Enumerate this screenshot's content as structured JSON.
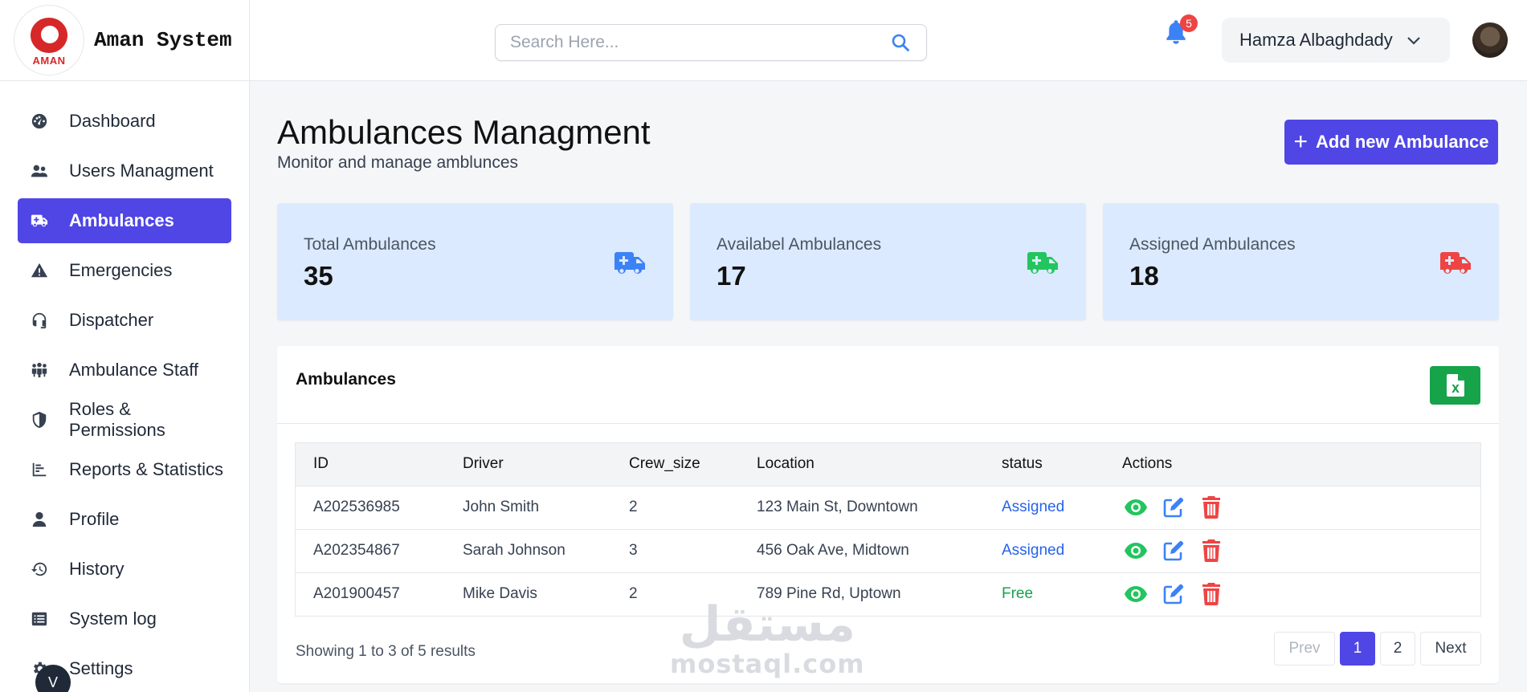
{
  "brand": {
    "logo_text": "AMAN",
    "name": "Aman System"
  },
  "sidebar": {
    "items": [
      {
        "label": "Dashboard",
        "icon": "gauge-icon"
      },
      {
        "label": "Users Managment",
        "icon": "users-icon"
      },
      {
        "label": "Ambulances",
        "icon": "ambulance-icon",
        "active": true
      },
      {
        "label": "Emergencies",
        "icon": "warning-icon"
      },
      {
        "label": "Dispatcher",
        "icon": "headset-icon"
      },
      {
        "label": "Ambulance Staff",
        "icon": "people-group-icon"
      },
      {
        "label": "Roles & Permissions",
        "icon": "shield-icon"
      },
      {
        "label": "Reports & Statistics",
        "icon": "chart-icon"
      },
      {
        "label": "Profile",
        "icon": "user-icon"
      },
      {
        "label": "History",
        "icon": "history-icon"
      },
      {
        "label": "System log",
        "icon": "log-icon"
      },
      {
        "label": "Settings",
        "icon": "gear-icon"
      }
    ],
    "scroll_glyph": "V"
  },
  "header": {
    "search_placeholder": "Search Here...",
    "notification_count": "5",
    "user_name": "Hamza Albaghdady"
  },
  "page": {
    "title": "Ambulances Managment",
    "subtitle": "Monitor and manage amblunces",
    "add_button": "Add new Ambulance",
    "add_button_plus": "+"
  },
  "stats": [
    {
      "label": "Total Ambulances",
      "value": "35",
      "color": "#3b82f6"
    },
    {
      "label": "Availabel Ambulances",
      "value": "17",
      "color": "#22c55e"
    },
    {
      "label": "Assigned Ambulances",
      "value": "18",
      "color": "#ef4444"
    }
  ],
  "table": {
    "title": "Ambulances",
    "columns": [
      "ID",
      "Driver",
      "Crew_size",
      "Location",
      "status",
      "Actions"
    ],
    "rows": [
      {
        "id": "A202536985",
        "driver": "John Smith",
        "crew": "2",
        "location": "123 Main St, Downtown",
        "status": "Assigned"
      },
      {
        "id": "A202354867",
        "driver": "Sarah Johnson",
        "crew": "3",
        "location": "456 Oak Ave, Midtown",
        "status": "Assigned"
      },
      {
        "id": "A201900457",
        "driver": "Mike Davis",
        "crew": "2",
        "location": "789 Pine Rd, Uptown",
        "status": "Free"
      }
    ],
    "showing": "Showing 1 to 3 of 5 results",
    "pager": {
      "prev": "Prev",
      "pages": [
        "1",
        "2"
      ],
      "next": "Next"
    }
  },
  "watermark": {
    "arabic": "مستقل",
    "latin": "mostaql.com"
  },
  "colors": {
    "accent": "#4f46e5",
    "assigned": "#2563eb",
    "free": "#16a34a",
    "view": "#22c55e",
    "edit": "#3b82f6",
    "delete": "#ef4444",
    "export": "#16a34a"
  }
}
